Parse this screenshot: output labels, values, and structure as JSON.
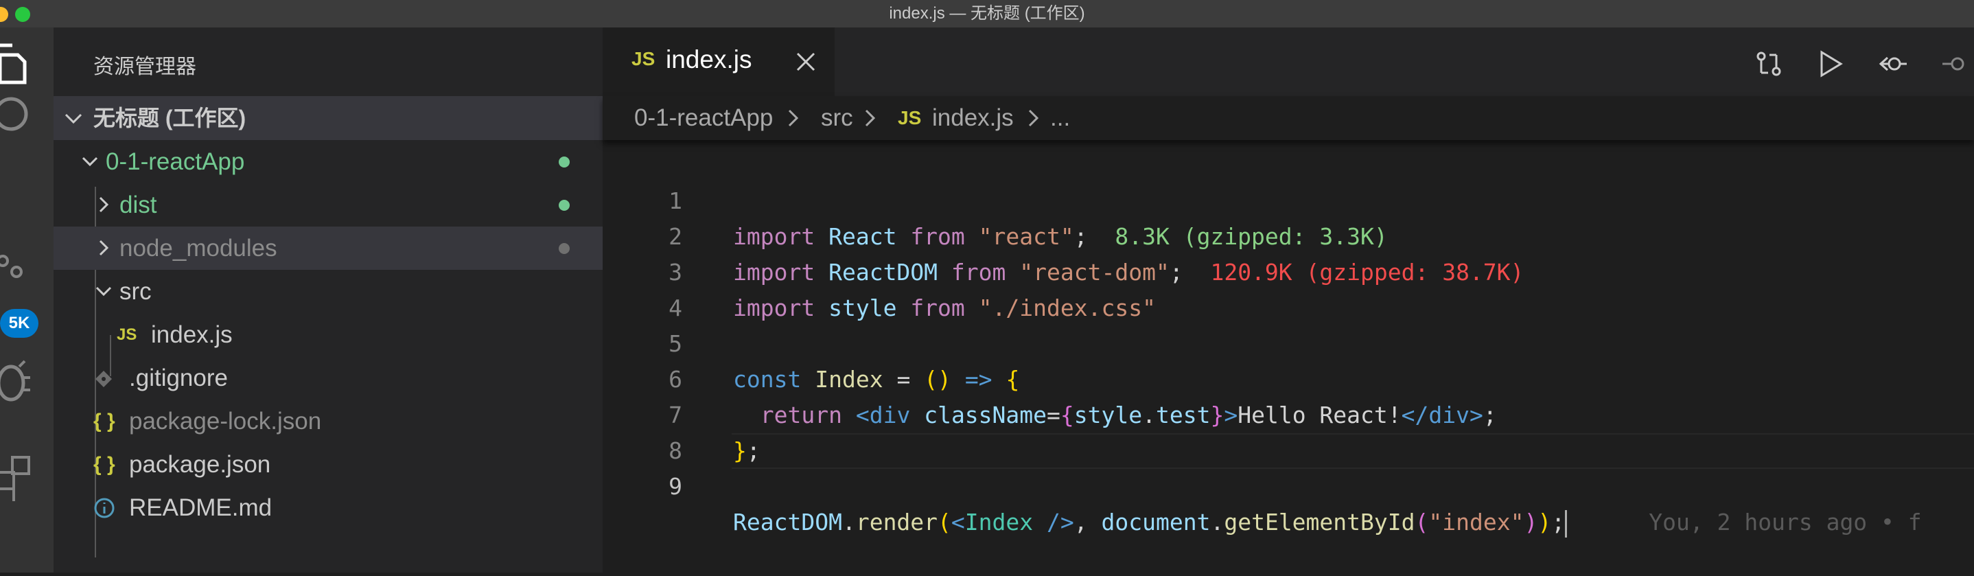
{
  "window": {
    "title": "index.js — 无标题 (工作区)"
  },
  "activity_bar": {
    "scm_badge": "5K"
  },
  "explorer": {
    "header": "资源管理器",
    "workspace_name": "无标题 (工作区)",
    "items": [
      {
        "label": "0-1-reactApp",
        "kind": "folder-open",
        "indent": 1,
        "color": "#73c991",
        "dot": "#73c991"
      },
      {
        "label": "dist",
        "kind": "folder-closed",
        "indent": 2,
        "color": "#73c991",
        "dot": "#73c991"
      },
      {
        "label": "node_modules",
        "kind": "folder-closed",
        "indent": 2,
        "color": "#8c8c8c",
        "dot": "#6f6f6f"
      },
      {
        "label": "src",
        "kind": "folder-open",
        "indent": 2,
        "color": "#cccccc"
      },
      {
        "label": "index.js",
        "kind": "js",
        "indent": 3,
        "color": "#cccccc"
      },
      {
        "label": ".gitignore",
        "kind": "git",
        "indent": 2,
        "color": "#cccccc"
      },
      {
        "label": "package-lock.json",
        "kind": "json",
        "indent": 2,
        "color": "#8c8c8c"
      },
      {
        "label": "package.json",
        "kind": "json",
        "indent": 2,
        "color": "#cccccc"
      },
      {
        "label": "README.md",
        "kind": "info",
        "indent": 2,
        "color": "#cccccc"
      }
    ]
  },
  "tabs": [
    {
      "icon_text": "JS",
      "label": "index.js",
      "active": true
    }
  ],
  "breadcrumb": {
    "parts": [
      "0-1-reactApp",
      "src",
      "index.js",
      "..."
    ],
    "file_icon_text": "JS"
  },
  "editor": {
    "line_numbers": [
      "1",
      "2",
      "3",
      "4",
      "5",
      "6",
      "7",
      "8",
      "9"
    ],
    "import_size_1": "8.3K (gzipped: 3.3K)",
    "import_size_2": "120.9K (gzipped: 38.7K)",
    "blame": "You, 2 hours ago • f"
  },
  "colors": {
    "accent": "#007acc",
    "git_added": "#73c991",
    "js_icon": "#cbcb41",
    "json_icon": "#cbcb41",
    "info_icon": "#519aba",
    "size_ok": "#89d185",
    "size_large": "#f14c4c"
  }
}
